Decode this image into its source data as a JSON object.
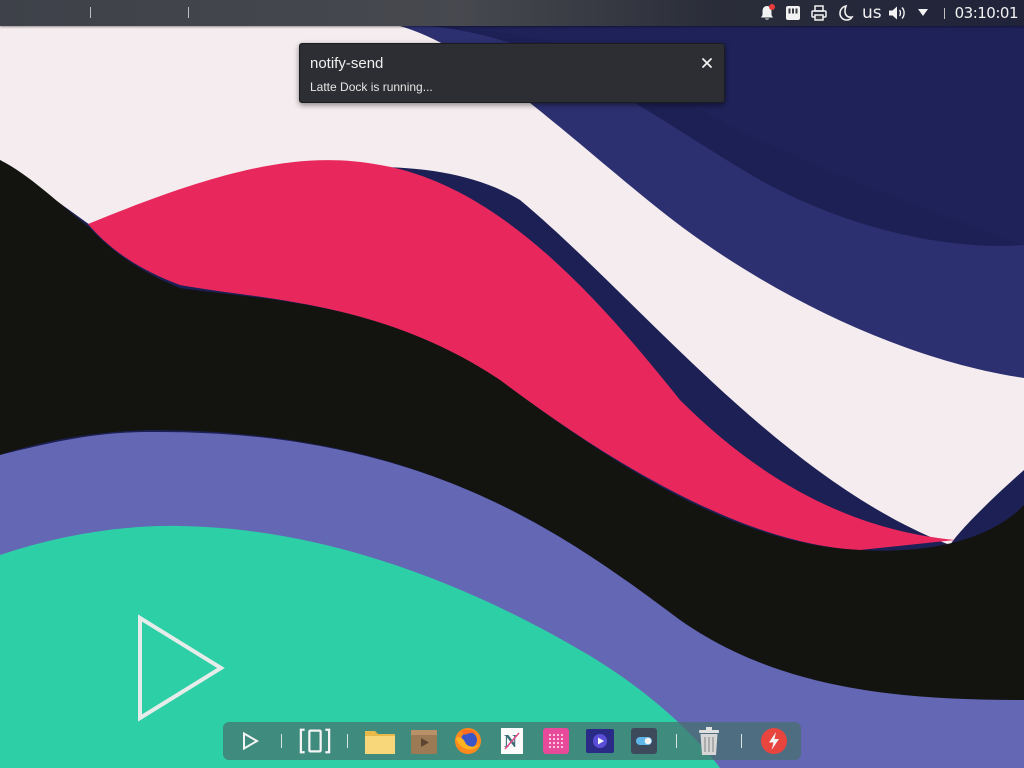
{
  "top_panel": {
    "tray_icons": [
      "notifications-icon",
      "network-icon",
      "printer-icon",
      "night-color-icon",
      "volume-icon",
      "show-hidden-icon"
    ],
    "keyboard_layout": "us",
    "clock": "03:10:01",
    "notifications_badge_color": "#ea3b3b"
  },
  "notification": {
    "title": "notify-send",
    "body": "Latte Dock is running...",
    "close_icon": "close-icon"
  },
  "dock": {
    "launchers": [
      {
        "name": "launcher-menu-icon"
      },
      {
        "name": "present-windows-icon"
      },
      {
        "name": "file-manager-icon"
      },
      {
        "name": "archive-manager-icon"
      },
      {
        "name": "firefox-icon"
      },
      {
        "name": "text-editor-icon"
      },
      {
        "name": "pink-grid-app-icon"
      },
      {
        "name": "media-player-icon"
      },
      {
        "name": "settings-toggle-icon"
      },
      {
        "name": "trash-icon"
      },
      {
        "name": "power-icon"
      }
    ]
  },
  "wallpaper": {
    "colors": {
      "navy": "#1f2258",
      "indigo": "#2d3070",
      "cream": "#f4ecee",
      "crimson": "#e8285c",
      "black": "#13140f",
      "periwinkle": "#6467b4",
      "teal": "#2dd0a6",
      "logo": "#e6ece9"
    }
  }
}
